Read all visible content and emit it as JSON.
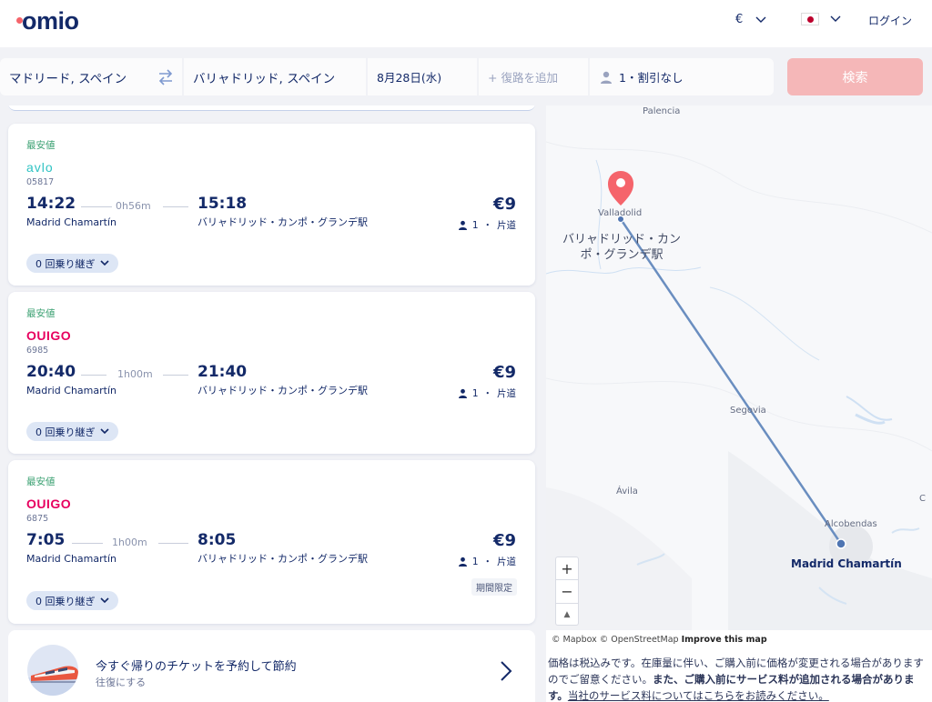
{
  "header": {
    "logo": "omio",
    "currency": "€",
    "login": "ログイン"
  },
  "search": {
    "origin": "マドリード, スペイン",
    "destination": "バリャドリッド, スペイン",
    "date": "8月28日(水)",
    "return_placeholder": "+ 復路を追加",
    "passengers": "1・割引なし",
    "search_button": "検索"
  },
  "results": [
    {
      "badge": "最安値",
      "carrier": "avlo",
      "train_no": "05817",
      "dep_time": "14:22",
      "duration": "0h56m",
      "arr_time": "15:18",
      "dep_station": "Madrid Chamartín",
      "arr_station": "バリャドリッド・カンポ・グランデ駅",
      "price": "€9",
      "pax": "1",
      "trip_type": "片道",
      "transfers": "0 回乗り継ぎ"
    },
    {
      "badge": "最安値",
      "carrier": "OUIGO",
      "train_no": "6985",
      "dep_time": "20:40",
      "duration": "1h00m",
      "arr_time": "21:40",
      "dep_station": "Madrid Chamartín",
      "arr_station": "バリャドリッド・カンポ・グランデ駅",
      "price": "€9",
      "pax": "1",
      "trip_type": "片道",
      "transfers": "0 回乗り継ぎ"
    },
    {
      "badge": "最安値",
      "carrier": "OUIGO",
      "train_no": "6875",
      "dep_time": "7:05",
      "duration": "1h00m",
      "arr_time": "8:05",
      "dep_station": "Madrid Chamartín",
      "arr_station": "バリャドリッド・カンポ・グランデ駅",
      "price": "€9",
      "pax": "1",
      "trip_type": "片道",
      "limited": "期間限定",
      "transfers": "0 回乗り継ぎ"
    }
  ],
  "promo": {
    "title": "今すぐ帰りのチケットを予約して節約",
    "subtitle": "往復にする"
  },
  "map": {
    "labels": {
      "palencia": "Palencia",
      "valladolid": "Valladolid",
      "arrival_station": "バリャドリッド・カンポ・グランデ駅",
      "segovia": "Segovia",
      "avila": "Ávila",
      "alcobendas": "Alcobendas",
      "madrid": "Madrid Chamartín",
      "edge": "C"
    },
    "zoom_in": "+",
    "zoom_out": "−",
    "compass": "▲",
    "attribution_mapbox": "© Mapbox © OpenStreetMap",
    "attribution_improve": "Improve this map"
  },
  "note": {
    "part1": "価格は税込みです。在庫量に伴い、ご購入前に価格が変更される場合がありますのでご留意ください。",
    "part2": "また、ご購入前にサービス料が追加される場合があります。",
    "part3": "当社のサービス料についてはこちらをお読みください。"
  },
  "colors": {
    "brand": "#132968",
    "logo_dot": "#f5646b",
    "cheapest": "#3aa071",
    "search_button": "#f5b7b8",
    "route": "#6a8ec0",
    "avlo": "#2fc3c3",
    "ouigo": "#e7005f"
  }
}
